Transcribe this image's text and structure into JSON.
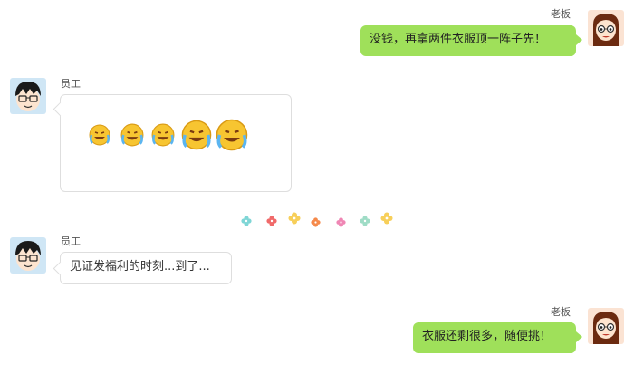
{
  "messages": [
    {
      "sender": "老板",
      "text": "没钱，再拿两件衣服顶一阵子先！"
    },
    {
      "sender": "员工",
      "emojis": [
        "laugh-cry-emoji",
        "laugh-cry-emoji",
        "laugh-cry-emoji",
        "laugh-cry-emoji",
        "laugh-cry-emoji"
      ]
    },
    {
      "sender": "员工",
      "text": "见证发福利的时刻...到了..."
    },
    {
      "sender": "老板",
      "text": "衣服还剩很多，随便挑！"
    }
  ],
  "divider": {
    "icons": [
      "clover-icon",
      "clover-icon",
      "clover-icon",
      "clover-icon",
      "clover-icon",
      "clover-icon",
      "clover-icon"
    ]
  },
  "colors": {
    "bubble_green": "#9fe05a",
    "bubble_border": "#dedede"
  }
}
